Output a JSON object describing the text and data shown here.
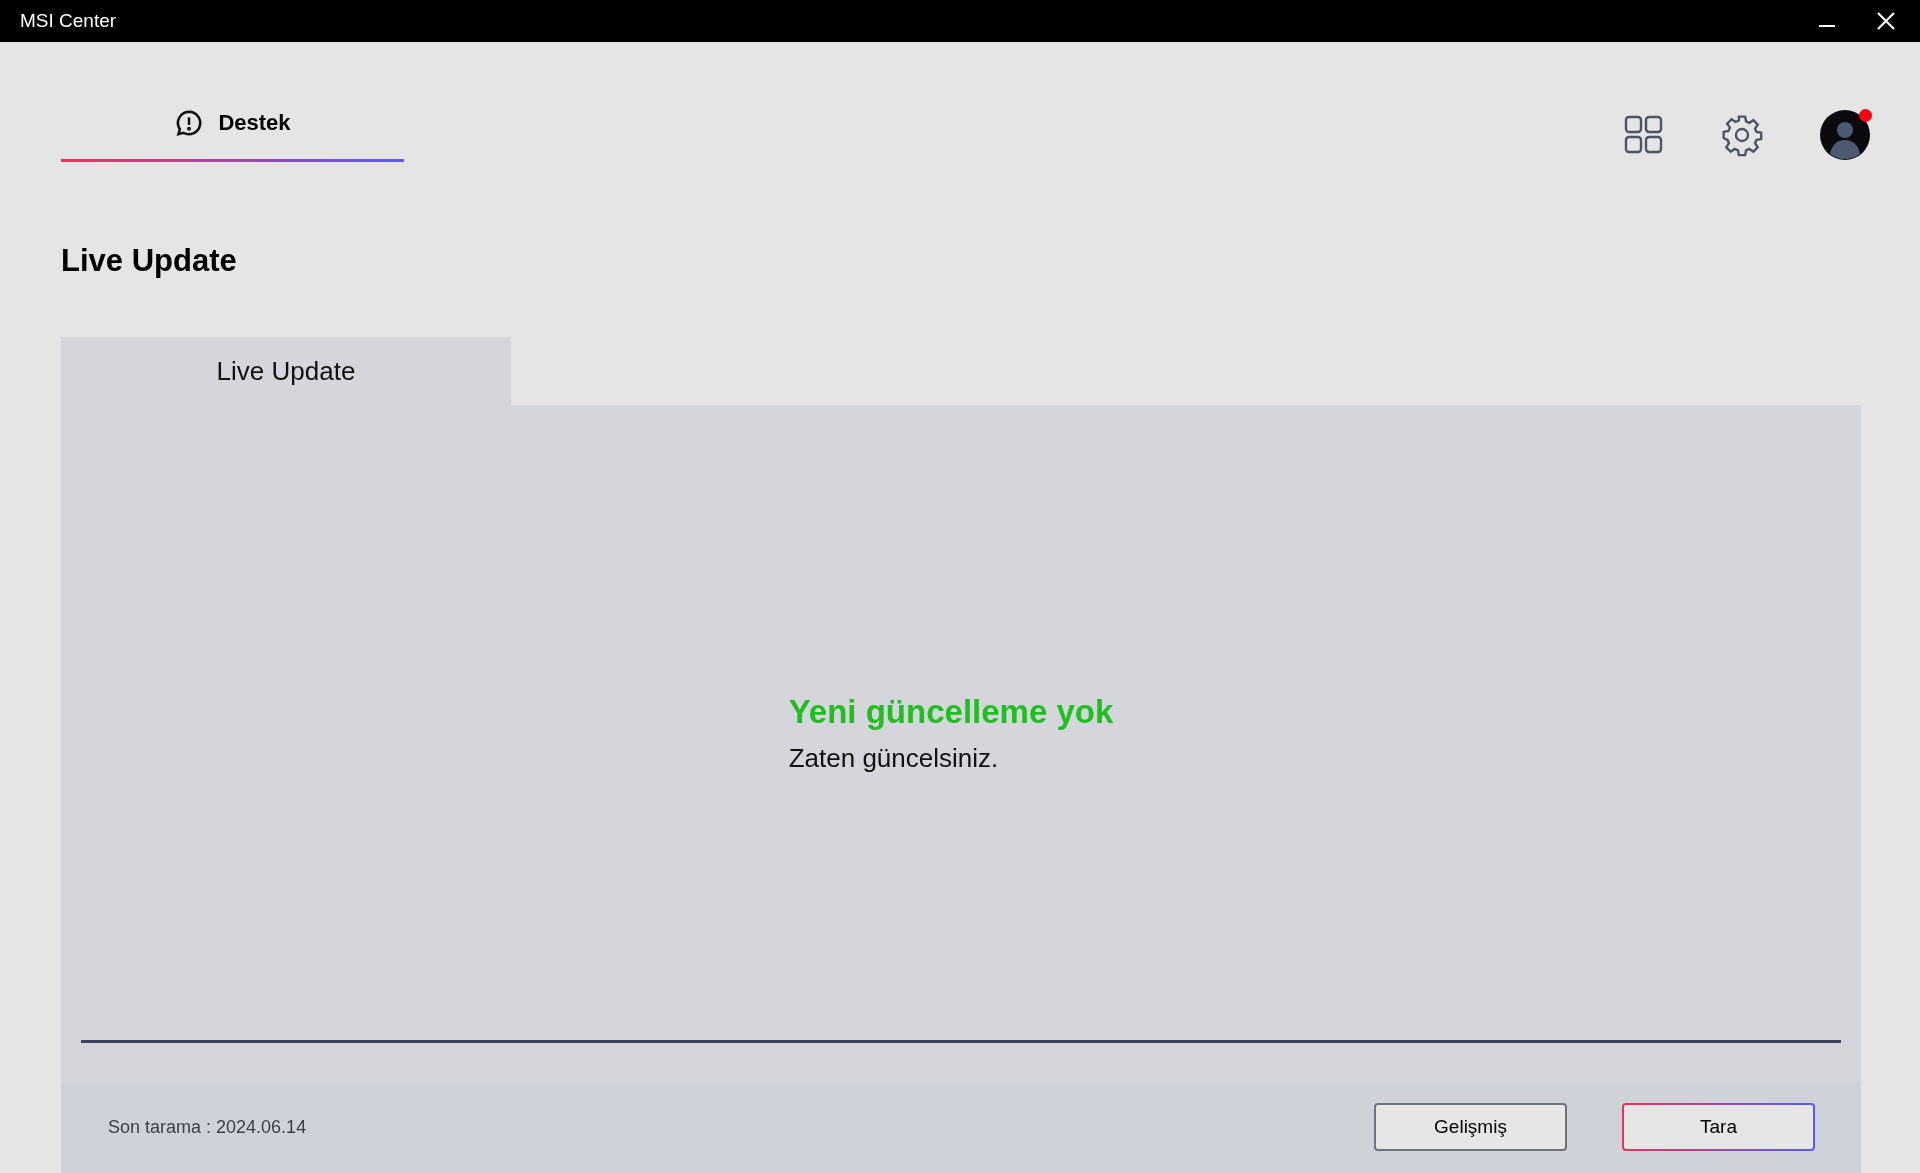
{
  "window": {
    "title": "MSI Center"
  },
  "nav_tabs": [
    {
      "label": "Destek",
      "selected": true
    }
  ],
  "profile": {
    "notification": true
  },
  "heading": "Live Update",
  "tabs": [
    {
      "label": "Live Update",
      "selected": true
    }
  ],
  "status": {
    "title": "Yeni güncelleme yok",
    "message": "Zaten güncelsiniz."
  },
  "last_scan": "Son tarama : 2024.06.14",
  "buttons": [
    {
      "label": "Gelişmiş",
      "kind": "secondary"
    },
    {
      "label": "Tara",
      "kind": "primary"
    }
  ]
}
